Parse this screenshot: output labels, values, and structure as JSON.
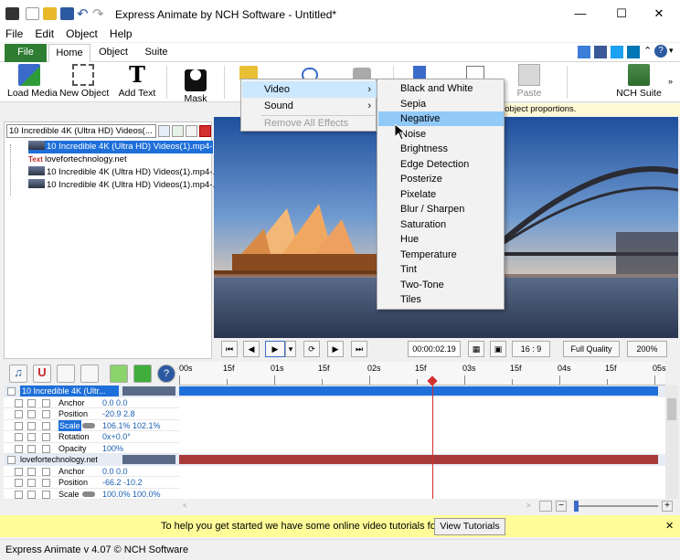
{
  "window": {
    "title": "Express Animate by NCH Software - Untitled*"
  },
  "menubar": {
    "items": [
      "File",
      "Edit",
      "Object",
      "Help"
    ]
  },
  "tabs": {
    "file": "File",
    "home": "Home",
    "object": "Object",
    "suite": "Suite"
  },
  "ribbon": {
    "load_media": "Load Media",
    "new_object": "New Object",
    "add_text": "Add Text",
    "mask": "Mask",
    "paste": "Paste",
    "nch_suite": "NCH Suite"
  },
  "notice": "t object proportions.",
  "object_panel": {
    "combo_value": "10 Incredible 4K (Ultra HD) Videos(...",
    "items": [
      "10 Incredible 4K (Ultra HD) Videos(1).mp4-...",
      "lovefortechnology.net",
      "10 Incredible 4K (Ultra HD) Videos(1).mp4-...",
      "10 Incredible 4K (Ultra HD) Videos(1).mp4-..."
    ],
    "text_badge": "Text"
  },
  "transport": {
    "time": "00:00:02.19",
    "aspect": "16 : 9",
    "quality": "Full Quality",
    "zoom": "200%"
  },
  "timeline": {
    "ruler_labels": [
      "00s",
      "15f",
      "01s",
      "15f",
      "02s",
      "15f",
      "03s",
      "15f",
      "04s",
      "15f",
      "05s"
    ],
    "track1": {
      "name": "10 Incredible 4K (Ultr...",
      "props": [
        {
          "name": "Anchor",
          "value": "0.0  0.0"
        },
        {
          "name": "Position",
          "value": "-20.9  2.8"
        },
        {
          "name": "Scale",
          "value": "106.1%  102.1%"
        },
        {
          "name": "Rotation",
          "value": "0x+0.0°"
        },
        {
          "name": "Opacity",
          "value": "100%"
        }
      ]
    },
    "track2": {
      "name": "lovefortechnology.net",
      "props": [
        {
          "name": "Anchor",
          "value": "0.0  0.0"
        },
        {
          "name": "Position",
          "value": "-66.2  -10.2"
        },
        {
          "name": "Scale",
          "value": "100.0%  100.0%"
        }
      ]
    }
  },
  "hint": {
    "text": "To help you get started we have some online video tutorials for you",
    "button": "View Tutorials"
  },
  "status": "Express Animate v 4.07 © NCH Software",
  "context_menu": {
    "items": [
      {
        "label": "Video",
        "submenu": true
      },
      {
        "label": "Sound",
        "submenu": true
      },
      {
        "label": "Remove All Effects",
        "disabled": true
      }
    ]
  },
  "video_submenu": {
    "items": [
      "Black and White",
      "Sepia",
      "Negative",
      "Noise",
      "Brightness",
      "Edge Detection",
      "Posterize",
      "Pixelate",
      "Blur / Sharpen",
      "Saturation",
      "Hue",
      "Temperature",
      "Tint",
      "Two-Tone",
      "Tiles"
    ]
  }
}
